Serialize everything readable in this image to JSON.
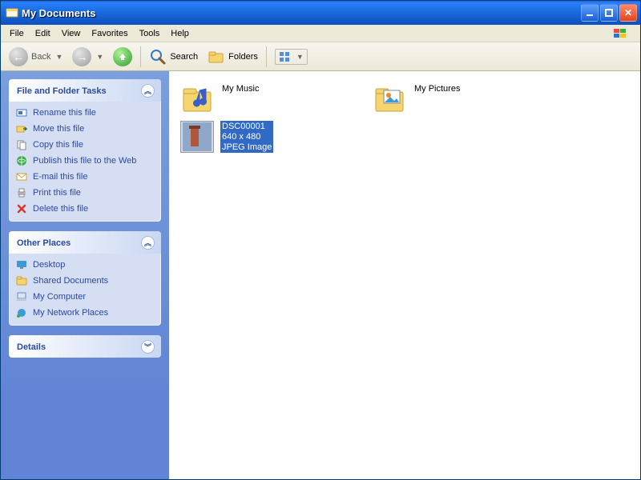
{
  "window": {
    "title": "My Documents"
  },
  "menu": {
    "file": "File",
    "edit": "Edit",
    "view": "View",
    "favorites": "Favorites",
    "tools": "Tools",
    "help": "Help"
  },
  "toolbar": {
    "back": "Back",
    "search": "Search",
    "folders": "Folders"
  },
  "sidebar": {
    "fileTasks": {
      "title": "File and Folder Tasks",
      "items": [
        {
          "icon": "rename-icon",
          "label": "Rename this file"
        },
        {
          "icon": "move-icon",
          "label": "Move this file"
        },
        {
          "icon": "copy-icon",
          "label": "Copy this file"
        },
        {
          "icon": "publish-icon",
          "label": "Publish this file to the Web"
        },
        {
          "icon": "email-icon",
          "label": "E-mail this file"
        },
        {
          "icon": "print-icon",
          "label": "Print this file"
        },
        {
          "icon": "delete-icon",
          "label": "Delete this file"
        }
      ]
    },
    "otherPlaces": {
      "title": "Other Places",
      "items": [
        {
          "icon": "desktop-icon",
          "label": "Desktop"
        },
        {
          "icon": "shared-docs-icon",
          "label": "Shared Documents"
        },
        {
          "icon": "my-computer-icon",
          "label": "My Computer"
        },
        {
          "icon": "network-places-icon",
          "label": "My Network Places"
        }
      ]
    },
    "details": {
      "title": "Details"
    }
  },
  "content": {
    "items": [
      {
        "type": "folder",
        "name": "My Music",
        "icon": "music-folder-icon",
        "selected": false
      },
      {
        "type": "folder",
        "name": "My Pictures",
        "icon": "pictures-folder-icon",
        "selected": false
      },
      {
        "type": "image",
        "name": "DSC00001",
        "dimensions": "640 x 480",
        "kind": "JPEG Image",
        "icon": "image-thumb-icon",
        "selected": true
      }
    ]
  }
}
